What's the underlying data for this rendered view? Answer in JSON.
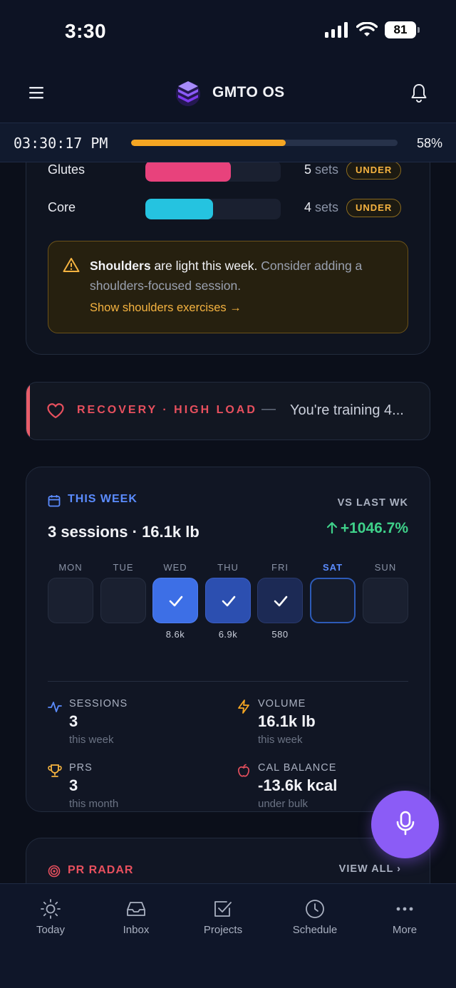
{
  "status": {
    "time": "3:30",
    "battery": "81"
  },
  "header": {
    "title": "GMTO OS"
  },
  "clock": {
    "time": "03:30:17 PM",
    "progress": 0.58,
    "percent_label": "58%"
  },
  "muscles": [
    {
      "name": "Glutes",
      "fill": 0.63,
      "color": "#e8427c",
      "sets_num": "5",
      "sets_unit": "sets",
      "badge": "UNDER"
    },
    {
      "name": "Core",
      "fill": 0.5,
      "color": "#25c3e0",
      "sets_num": "4",
      "sets_unit": "sets",
      "badge": "UNDER"
    }
  ],
  "warning": {
    "bold": "Shoulders",
    "text1": " are light this week.",
    "text2": " Consider adding a shoulders-focused session.",
    "link": "Show shoulders exercises →"
  },
  "recovery": {
    "label": "RECOVERY · HIGH LOAD",
    "dash": "—",
    "message": "You're training 4..."
  },
  "week": {
    "label": "THIS WEEK",
    "vs_label": "VS LAST WK",
    "summary": "3 sessions · 16.1k lb",
    "delta": "+1046.7%",
    "days": [
      {
        "name": "MON",
        "volume": ""
      },
      {
        "name": "TUE",
        "volume": ""
      },
      {
        "name": "WED",
        "volume": "8.6k"
      },
      {
        "name": "THU",
        "volume": "6.9k"
      },
      {
        "name": "FRI",
        "volume": "580"
      },
      {
        "name": "SAT",
        "volume": ""
      },
      {
        "name": "SUN",
        "volume": ""
      }
    ],
    "stats": {
      "sessions": {
        "label": "SESSIONS",
        "value": "3",
        "sub": "this week"
      },
      "volume": {
        "label": "VOLUME",
        "value": "16.1k lb",
        "sub": "this week"
      },
      "prs": {
        "label": "PRS",
        "value": "3",
        "sub": "this month"
      },
      "cal": {
        "label": "CAL BALANCE",
        "value": "-13.6k kcal",
        "sub": "under bulk"
      }
    }
  },
  "pr_radar": {
    "label": "PR RADAR",
    "view_all": "VIEW ALL ›"
  },
  "tabs": [
    {
      "label": "Today",
      "icon": "sun-icon"
    },
    {
      "label": "Inbox",
      "icon": "inbox-icon"
    },
    {
      "label": "Projects",
      "icon": "checkbox-icon"
    },
    {
      "label": "Schedule",
      "icon": "clock-icon"
    },
    {
      "label": "More",
      "icon": "more-icon"
    }
  ]
}
